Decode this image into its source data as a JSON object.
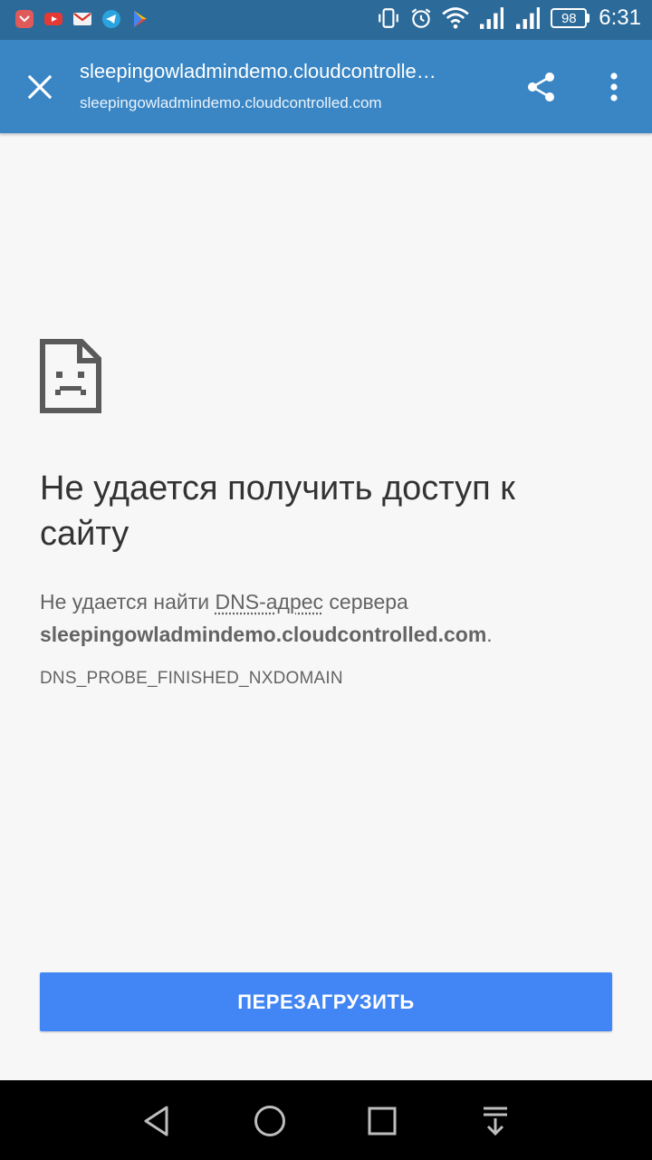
{
  "status_bar": {
    "time": "6:31",
    "battery_level": "98",
    "notification_icons": [
      "missed-call-icon",
      "youtube-icon",
      "gmail-icon",
      "telegram-icon",
      "play-store-icon"
    ],
    "system_icons": [
      "vibrate-icon",
      "alarm-icon",
      "wifi-icon",
      "signal-icon",
      "signal-icon"
    ]
  },
  "app_bar": {
    "title": "sleepingowladmindemo.cloudcontrolled.com",
    "url": "sleepingowladmindemo.cloudcontrolled.com",
    "bg_color": "#3a86c4"
  },
  "error": {
    "heading": "Не удается получить доступ к сайту",
    "message_prefix": "Не удается найти",
    "message_abbr": "DNS-адрес",
    "message_suffix": "сервера",
    "host": "sleepingowladmindemo.cloudcontrolled.com",
    "host_period": ".",
    "code": "DNS_PROBE_FINISHED_NXDOMAIN"
  },
  "reload_button": {
    "label": "ПЕРЕЗАГРУЗИТЬ",
    "color": "#4285f4"
  },
  "nav_bar": {
    "buttons": [
      "back-icon",
      "home-icon",
      "recents-icon",
      "notification-pull-icon"
    ]
  }
}
